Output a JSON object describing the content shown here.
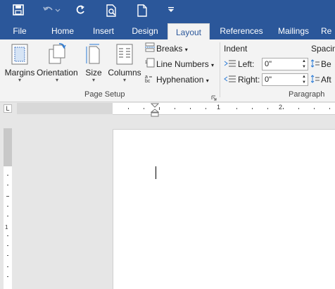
{
  "quick_access": {
    "save": "save-icon",
    "undo": "undo-icon",
    "redo": "redo-icon",
    "print_preview": "print-preview-icon",
    "new": "new-document-icon",
    "customize": "customize-qat-icon"
  },
  "tabs": [
    {
      "label": "File"
    },
    {
      "label": "Home"
    },
    {
      "label": "Insert"
    },
    {
      "label": "Design"
    },
    {
      "label": "Layout"
    },
    {
      "label": "References"
    },
    {
      "label": "Mailings"
    },
    {
      "label": "Re"
    }
  ],
  "page_setup": {
    "margins": "Margins",
    "orientation": "Orientation",
    "size": "Size",
    "columns": "Columns",
    "breaks": "Breaks",
    "line_numbers": "Line Numbers",
    "hyphenation": "Hyphenation",
    "group_label": "Page Setup"
  },
  "paragraph": {
    "indent_heading": "Indent",
    "left_label": "Left:",
    "left_value": "0\"",
    "right_label": "Right:",
    "right_value": "0\"",
    "spacing_heading": "Spacing",
    "before_label": "Be",
    "after_label": "Aft",
    "group_label": "Paragraph"
  },
  "ruler": {
    "mark1": "1",
    "mark2": "2",
    "tab_selector": "L"
  },
  "colors": {
    "accent": "#2b579a",
    "ribbon": "#f3f3f3"
  }
}
